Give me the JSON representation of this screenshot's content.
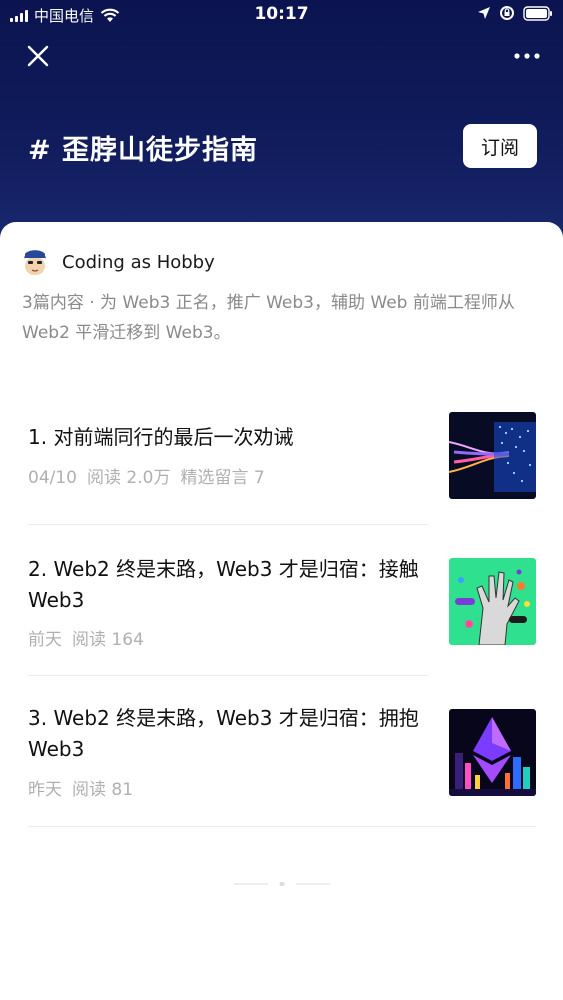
{
  "status_bar": {
    "carrier": "中国电信",
    "time": "10:17"
  },
  "topic": {
    "title": "# 歪脖山徒步指南",
    "subscribe_label": "订阅"
  },
  "author": {
    "name": "Coding as Hobby"
  },
  "description": "3篇内容 · 为 Web3 正名，推广 Web3，辅助 Web 前端工程师从 Web2 平滑迁移到 Web3。",
  "articles": [
    {
      "title": "1. 对前端同行的最后一次劝诫",
      "date": "04/10",
      "reads": "阅读 2.0万",
      "comments": "精选留言 7",
      "thumb_icon": "data-stream-thumbnail"
    },
    {
      "title": "2. Web2 终是末路，Web3 才是归宿：接触 Web3",
      "date": "前天",
      "reads": "阅读 164",
      "thumb_icon": "robot-hand-thumbnail"
    },
    {
      "title": "3. Web2 终是末路，Web3 才是归宿：拥抱 Web3",
      "date": "昨天",
      "reads": "阅读 81",
      "thumb_icon": "ethereum-city-thumbnail"
    }
  ],
  "colors": {
    "header_dark": "#0b1450",
    "header_light": "#1b2a72",
    "meta_gray": "#b0b0b0",
    "thumb_green": "#2fe08e"
  }
}
